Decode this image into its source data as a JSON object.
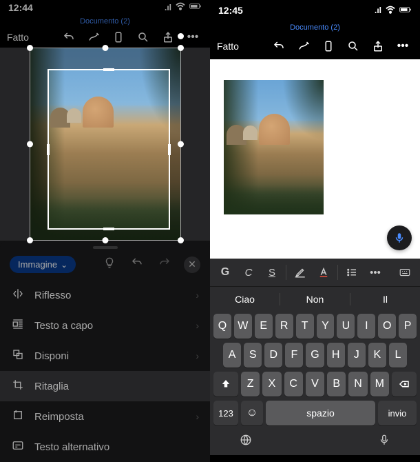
{
  "left": {
    "status": {
      "time": "12:44",
      "signal": "••ıl",
      "wifi": "⌃",
      "battery": "▢"
    },
    "doc_title": "Documento (2)",
    "toolbar": {
      "done": "Fatto"
    },
    "drawer": {
      "chip": "Immagine",
      "items": [
        {
          "icon": "reflect",
          "label": "Riflesso",
          "chevron": true
        },
        {
          "icon": "wrap",
          "label": "Testo a capo",
          "chevron": true
        },
        {
          "icon": "arrange",
          "label": "Disponi",
          "chevron": true
        },
        {
          "icon": "crop",
          "label": "Ritaglia",
          "chevron": false,
          "active": true
        },
        {
          "icon": "reset",
          "label": "Reimposta",
          "chevron": true
        },
        {
          "icon": "alt",
          "label": "Testo alternativo",
          "chevron": false
        }
      ]
    }
  },
  "right": {
    "status": {
      "time": "12:45",
      "signal": "••ıl",
      "wifi": "⌃",
      "battery": "▢"
    },
    "doc_title": "Documento (2)",
    "toolbar": {
      "done": "Fatto"
    },
    "format": {
      "b": "G",
      "i": "C",
      "u": "S"
    },
    "suggestions": [
      "Ciao",
      "Non",
      "Il"
    ],
    "keyboard": {
      "row1": [
        "Q",
        "W",
        "E",
        "R",
        "T",
        "Y",
        "U",
        "I",
        "O",
        "P"
      ],
      "row2": [
        "A",
        "S",
        "D",
        "F",
        "G",
        "H",
        "J",
        "K",
        "L"
      ],
      "row3": [
        "Z",
        "X",
        "C",
        "V",
        "B",
        "N",
        "M"
      ],
      "num": "123",
      "space": "spazio",
      "enter": "invio"
    }
  }
}
